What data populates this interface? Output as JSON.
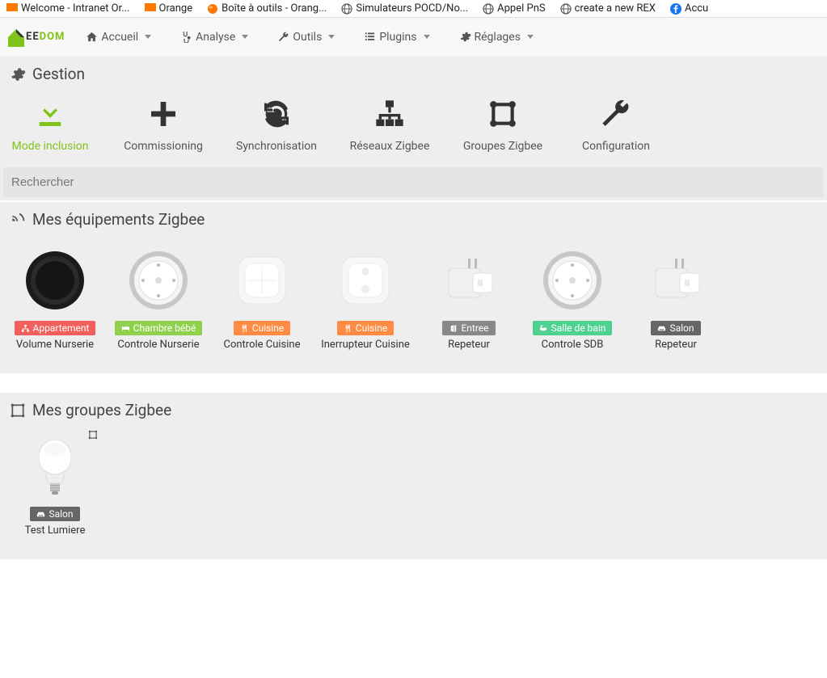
{
  "browser_tabs": [
    {
      "label": "Welcome - Intranet Or...",
      "icon": "orange"
    },
    {
      "label": "Orange",
      "icon": "orange"
    },
    {
      "label": "Boîte à outils - Orang...",
      "icon": "orange-ball"
    },
    {
      "label": "Simulateurs POCD/No...",
      "icon": "globe"
    },
    {
      "label": "Appel PnS",
      "icon": "globe"
    },
    {
      "label": "create a new REX",
      "icon": "globe"
    },
    {
      "label": "Accu",
      "icon": "facebook"
    }
  ],
  "logo_text": {
    "ee": "EE",
    "dom": "DOM"
  },
  "nav": [
    {
      "icon": "home",
      "label": "Accueil"
    },
    {
      "icon": "stethoscope",
      "label": "Analyse"
    },
    {
      "icon": "wrench",
      "label": "Outils"
    },
    {
      "icon": "list",
      "label": "Plugins"
    },
    {
      "icon": "gear",
      "label": "Réglages"
    }
  ],
  "sections": {
    "gestion": "Gestion",
    "equip": "Mes équipements Zigbee",
    "groups": "Mes groupes Zigbee"
  },
  "gestion": [
    {
      "id": "mode-inclusion",
      "icon": "download",
      "label": "Mode inclusion",
      "active": true
    },
    {
      "id": "commissioning",
      "icon": "plus",
      "label": "Commissioning"
    },
    {
      "id": "sync",
      "icon": "sync",
      "label": "Synchronisation"
    },
    {
      "id": "networks",
      "icon": "network",
      "label": "Réseaux Zigbee"
    },
    {
      "id": "groups",
      "icon": "group",
      "label": "Groupes Zigbee"
    },
    {
      "id": "config",
      "icon": "wrench",
      "label": "Configuration"
    }
  ],
  "search": {
    "placeholder": "Rechercher"
  },
  "equipment": [
    {
      "img": "black-dial",
      "name": "Volume Nurserie",
      "tag_label": "Appartement",
      "tag_icon": "sitemap",
      "tag_color": "#f25f5c"
    },
    {
      "img": "white-dial",
      "name": "Controle Nurserie",
      "tag_label": "Chambre bébé",
      "tag_icon": "bed",
      "tag_color": "#8fd14f"
    },
    {
      "img": "white-remote",
      "name": "Controle Cuisine",
      "tag_label": "Cuisine",
      "tag_icon": "utensils",
      "tag_color": "#ff8c42"
    },
    {
      "img": "white-switch",
      "name": "Inerrupteur Cuisine",
      "tag_label": "Cuisine",
      "tag_icon": "utensils",
      "tag_color": "#ff8c42"
    },
    {
      "img": "plug",
      "name": "Repeteur",
      "tag_label": "Entree",
      "tag_icon": "door",
      "tag_color": "#888"
    },
    {
      "img": "white-dial",
      "name": "Controle SDB",
      "tag_label": "Salle de bain",
      "tag_icon": "bath",
      "tag_color": "#4fd18f"
    },
    {
      "img": "plug",
      "name": "Repeteur",
      "tag_label": "Salon",
      "tag_icon": "couch",
      "tag_color": "#666"
    }
  ],
  "groups_list": [
    {
      "img": "bulb",
      "name": "Test Lumiere",
      "tag_label": "Salon",
      "tag_icon": "couch",
      "tag_color": "#666"
    }
  ]
}
